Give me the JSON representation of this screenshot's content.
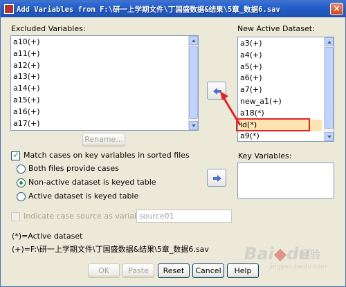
{
  "window": {
    "title": "Add Variables from F:\\研一上学期文件\\丁国盛数据&结果\\5章_数据6.sav",
    "close_glyph": "×"
  },
  "excluded": {
    "label": "Excluded Variables:",
    "items": [
      "a10(+)",
      "a11(+)",
      "a12(+)",
      "a13(+)",
      "a14(+)",
      "a15(+)",
      "a16(+)",
      "a17(+)"
    ]
  },
  "active": {
    "label": "New Active Dataset:",
    "items": [
      "a3(+)",
      "a4(+)",
      "a5(+)",
      "a6(+)",
      "a7(+)",
      "new_a1(+)",
      "a18(*)",
      "id(*)",
      "a9(*)"
    ]
  },
  "key": {
    "label": "Key Variables:"
  },
  "rename_label": "Rename...",
  "match": {
    "label": "Match cases on key variables in sorted files",
    "options": [
      "Both files provide cases",
      "Non-active dataset is keyed table",
      "Active dataset is keyed table"
    ],
    "selected_index": 1
  },
  "indicate": {
    "label": "Indicate case source as variable:",
    "value": "source01"
  },
  "legend": {
    "star": "(*)=Active dataset",
    "plus": "(+)=F:\\研一上学期文件\\丁国盛数据&结果\\5章_数据6.sav"
  },
  "buttons": {
    "ok": "OK",
    "paste": "Paste",
    "reset": "Reset",
    "cancel": "Cancel",
    "help": "Help"
  },
  "watermark": {
    "brand": "Bai",
    "suffix": "du",
    "sub": "经验",
    "url": "jingyan.baidu.com"
  },
  "colors": {
    "titlebar": "#245fc7",
    "highlight": "#e0242a",
    "arrow": "#4d6fd0"
  }
}
